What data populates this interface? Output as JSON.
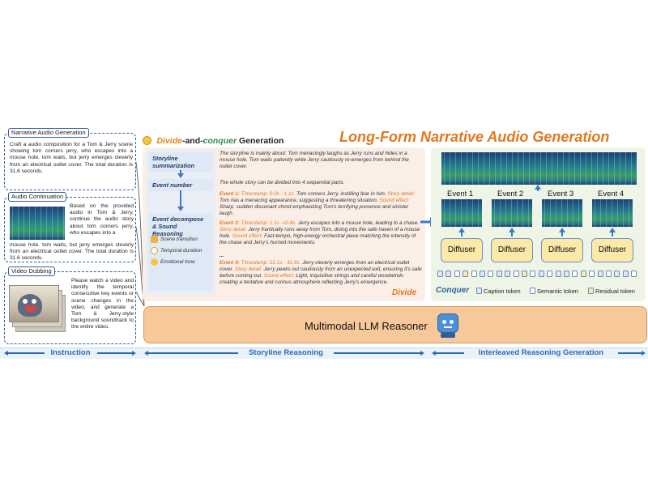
{
  "instruction": {
    "narrative": {
      "label": "Narrative Audio Generation",
      "text": "Craft a audio composition for a Tom & Jerry scene showing tom corners jerry, who escapes into a mouse hole. tom waits, but jerry emerges cleverly from an electrical outlet cover. The total duration is 31.6 seconds."
    },
    "continuation": {
      "label": "Audio Continuation",
      "text_side": "Based on the provided audio in Tom & Jerry, continue the audio story about tom corners jerry, who escapes into a",
      "text_bottom": "mouse hole. tom waits, but jerry emerges cleverly from an electrical outlet cover. The total duration is 31.6 seconds."
    },
    "dubbing": {
      "label": "Video Dubbing",
      "text": "Please watch a video and identify the temporal consecutive key events or scene changes in the video, and generate a Tom & Jerry-style background soundtrack to the entire video."
    }
  },
  "header": {
    "dc_part1": "Divide",
    "dc_mid": "-and-",
    "dc_part2": "conquer",
    "dc_part3": " Generation",
    "main_title": "Long-Form Narrative Audio Generation"
  },
  "storyline": {
    "steps": {
      "summarization": "Storyline summarization",
      "event_number": "Event number",
      "decompose": "Event decompose & Sound Reasoning"
    },
    "sub_items": [
      "Scene transition",
      "Temporal duration",
      "Emotional tone"
    ],
    "summary_text": "The storyline is mainly about: Tom menacingly laughs as Jerry runs and hides in a mouse hole. Tom waits patiently while Jerry cautiously re-emerges from behind the outlet cover.",
    "count_text": "The whole story can be divided into 4 sequential parts.",
    "events": [
      {
        "head": "Event 1:",
        "ts_label": "Timestamp:",
        "ts": "0.0s - 1.1s.",
        "ts_text": "Tom corners Jerry, instilling fear in him.",
        "sd_label": "Story detail:",
        "sd_text": "Tom has a menacing appearance, suggesting a threatening situation.",
        "se_label": "Sound effect:",
        "se_text": "Sharp, sudden dissonant chord emphasizing Tom's terrifying presence and sinister laugh."
      },
      {
        "head": "Event 2:",
        "ts_label": "Timestamp:",
        "ts": "1.1s -10.8s.",
        "ts_text": "Jerry escapes into a mouse hole, leading to a chase.",
        "sd_label": "Story detail:",
        "sd_text": "Jerry frantically runs away from Tom, diving into the safe haven of a mouse hole.",
        "se_label": "Sound effect:",
        "se_text": "Fast-tempo, high-energy orchestral piece matching the intensity of the chase and Jerry's hurried movements."
      },
      {
        "head": "Event 4:",
        "ts_label": "Timestamp:",
        "ts": "22.1s - 31.6s.",
        "ts_text": "Jerry cleverly emerges from an electrical outlet cover.",
        "sd_label": "Story detail:",
        "sd_text": "Jerry peeks out cautiously from an unexpected exit, ensuring it's safe before coming out.",
        "se_label": "Sound effect:",
        "se_text": "Light, inquisitive strings and careful woodwinds creating a tentative and curious atmosphere reflecting Jerry's emergence."
      }
    ],
    "ellipsis": "...",
    "divide_label": "Divide"
  },
  "conquer": {
    "events": [
      "Event 1",
      "Event 2",
      "Event 3",
      "Event 4"
    ],
    "diffuser_label": "Diffuser",
    "conquer_label": "Conquer",
    "legend": [
      "Caption token",
      "Semantic token",
      "Residual token"
    ]
  },
  "llm": {
    "label": "Multimodal LLM Reasoner"
  },
  "bottom": {
    "instruction": "Instruction",
    "storyline": "Storyline Reasoning",
    "interleaved": "Interleaved Reasoning Generation"
  },
  "colors": {
    "accent_orange": "#e0781f",
    "accent_blue": "#2b69b5",
    "diffuser_fill": "#fbe9a8",
    "llm_fill": "#f7c89a"
  }
}
